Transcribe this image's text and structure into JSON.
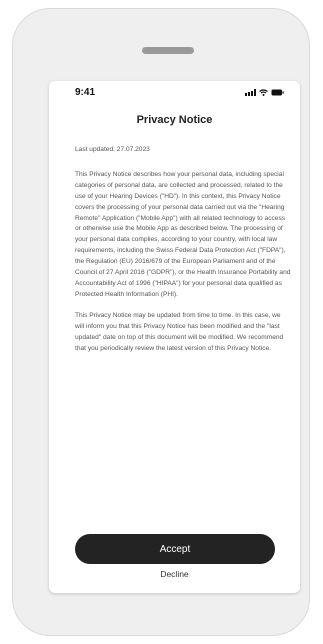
{
  "statusbar": {
    "time": "9:41",
    "icons": [
      "signal-icon",
      "wifi-icon",
      "battery-icon"
    ]
  },
  "notice": {
    "title": "Privacy Notice",
    "last_updated": "Last updated: 27.07.2023",
    "paragraphs": [
      "This Privacy Notice describes how your personal data, including special categories of personal data, are collected and processed, related to the use of your Hearing Devices (\"HD\"). In this context, this Privacy Notice covers the processing of your personal data carried out via the \"Hearing Remote\" Application (\"Mobile App\") with all related technology to access or otherwise use the Mobile App as described below. The processing of your personal data complies, according to your country, with local law requirements, including the Swiss Federal Data Protection Act (\"FDPA\"), the Regulation (EU) 2016/679 of the European Parliament and of the Council of 27 April 2016 (\"GDPR\"), or the Health Insurance Portability and Accountability Act of 1996 (\"HIPAA\") for your personal data qualified as Protected Health Information (PHI).",
      "This Privacy Notice may be updated from time to time. In this case, we will inform you that this Privacy Notice has been modified and the \"last updated\" date on top of this document will be modified. We recommend that you periodically review the latest version of this Privacy Notice."
    ]
  },
  "actions": {
    "accept_label": "Accept",
    "decline_label": "Decline"
  },
  "colors": {
    "accept_button": "#232323",
    "device_frame": "#efefef"
  }
}
